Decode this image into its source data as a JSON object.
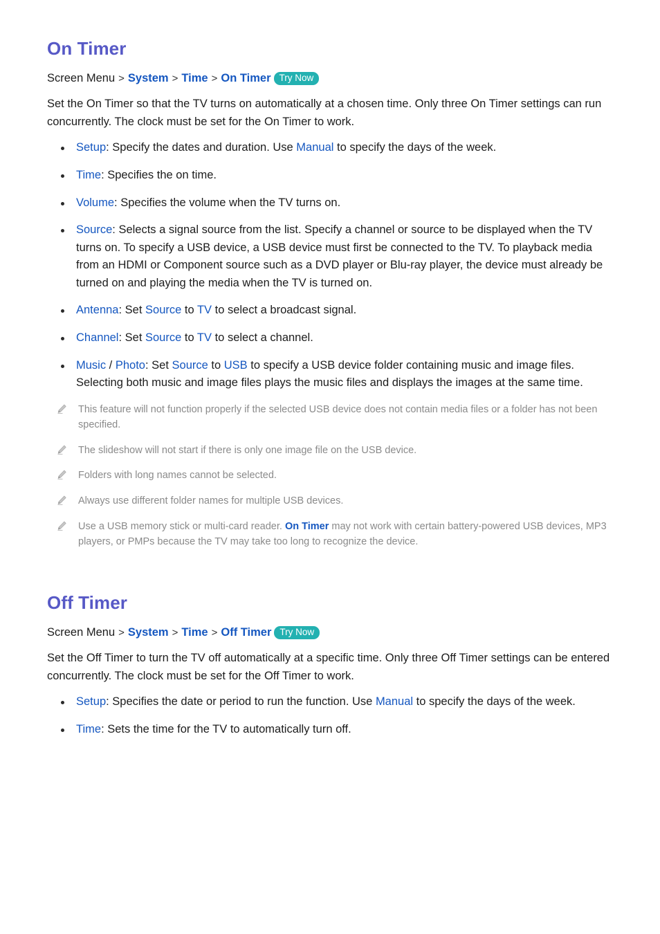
{
  "sections": [
    {
      "title": "On Timer",
      "breadcrumb": {
        "root": "Screen Menu",
        "links": [
          "System",
          "Time",
          "On Timer"
        ],
        "separator": ">",
        "badge": "Try Now"
      },
      "intro": "Set the On Timer so that the TV turns on automatically at a chosen time. Only three On Timer settings can run concurrently. The clock must be set for the On Timer to work.",
      "bullets": [
        {
          "parts": [
            {
              "t": "Setup",
              "s": "kw"
            },
            {
              "t": ": Specify the dates and duration. Use ",
              "s": "plain"
            },
            {
              "t": "Manual",
              "s": "kw"
            },
            {
              "t": " to specify the days of the week.",
              "s": "plain"
            }
          ]
        },
        {
          "parts": [
            {
              "t": "Time",
              "s": "kw"
            },
            {
              "t": ": Specifies the on time.",
              "s": "plain"
            }
          ]
        },
        {
          "parts": [
            {
              "t": "Volume",
              "s": "kw"
            },
            {
              "t": ": Specifies the volume when the TV turns on.",
              "s": "plain"
            }
          ]
        },
        {
          "parts": [
            {
              "t": "Source",
              "s": "kw"
            },
            {
              "t": ": Selects a signal source from the list. Specify a channel or source to be displayed when the TV turns on. To specify a USB device, a USB device must first be connected to the TV. To playback media from an HDMI or Component source such as a DVD player or Blu-ray player, the device must already be turned on and playing the media when the TV is turned on.",
              "s": "plain"
            }
          ]
        },
        {
          "parts": [
            {
              "t": "Antenna",
              "s": "kw"
            },
            {
              "t": ": Set ",
              "s": "plain"
            },
            {
              "t": "Source",
              "s": "kw"
            },
            {
              "t": " to ",
              "s": "plain"
            },
            {
              "t": "TV",
              "s": "kw"
            },
            {
              "t": " to select a broadcast signal.",
              "s": "plain"
            }
          ]
        },
        {
          "parts": [
            {
              "t": "Channel",
              "s": "kw"
            },
            {
              "t": ": Set ",
              "s": "plain"
            },
            {
              "t": "Source",
              "s": "kw"
            },
            {
              "t": " to ",
              "s": "plain"
            },
            {
              "t": "TV",
              "s": "kw"
            },
            {
              "t": " to select a channel.",
              "s": "plain"
            }
          ]
        },
        {
          "parts": [
            {
              "t": "Music",
              "s": "kw"
            },
            {
              "t": " / ",
              "s": "plain"
            },
            {
              "t": "Photo",
              "s": "kw"
            },
            {
              "t": ": Set ",
              "s": "plain"
            },
            {
              "t": "Source",
              "s": "kw"
            },
            {
              "t": " to ",
              "s": "plain"
            },
            {
              "t": "USB",
              "s": "kw"
            },
            {
              "t": " to specify a USB device folder containing music and image files. Selecting both music and image files plays the music files and displays the images at the same time.",
              "s": "plain"
            }
          ]
        }
      ],
      "notes": [
        {
          "icon": "pencil-icon",
          "parts": [
            {
              "t": "This feature will not function properly if the selected USB device does not contain media files or a folder has not been specified.",
              "s": "plain"
            }
          ]
        },
        {
          "icon": "pencil-icon",
          "parts": [
            {
              "t": "The slideshow will not start if there is only one image file on the USB device.",
              "s": "plain"
            }
          ]
        },
        {
          "icon": "pencil-icon",
          "parts": [
            {
              "t": "Folders with long names cannot be selected.",
              "s": "plain"
            }
          ]
        },
        {
          "icon": "pencil-icon",
          "parts": [
            {
              "t": "Always use different folder names for multiple USB devices.",
              "s": "plain"
            }
          ]
        },
        {
          "icon": "pencil-icon",
          "parts": [
            {
              "t": "Use a USB memory stick or multi-card reader. ",
              "s": "plain"
            },
            {
              "t": "On Timer",
              "s": "note-kw"
            },
            {
              "t": " may not work with certain battery-powered USB devices, MP3 players, or PMPs because the TV may take too long to recognize the device.",
              "s": "plain"
            }
          ]
        }
      ]
    },
    {
      "title": "Off Timer",
      "breadcrumb": {
        "root": "Screen Menu",
        "links": [
          "System",
          "Time",
          "Off Timer"
        ],
        "separator": ">",
        "badge": "Try Now"
      },
      "intro": "Set the Off Timer to turn the TV off automatically at a specific time. Only three Off Timer settings can be entered concurrently. The clock must be set for the Off Timer to work.",
      "bullets": [
        {
          "parts": [
            {
              "t": "Setup",
              "s": "kw"
            },
            {
              "t": ": Specifies the date or period to run the function. Use ",
              "s": "plain"
            },
            {
              "t": "Manual",
              "s": "kw"
            },
            {
              "t": " to specify the days of the week.",
              "s": "plain"
            }
          ]
        },
        {
          "parts": [
            {
              "t": "Time",
              "s": "kw"
            },
            {
              "t": ": Sets the time for the TV to automatically turn off.",
              "s": "plain"
            }
          ]
        }
      ],
      "notes": []
    }
  ],
  "colors": {
    "heading": "#5759c6",
    "link": "#1557c0",
    "badge_bg": "#23b1b1",
    "badge_text": "#ffffff",
    "body_text": "#1c1c1c",
    "note_text": "#8a8a8a",
    "page_bg": "#ffffff"
  }
}
